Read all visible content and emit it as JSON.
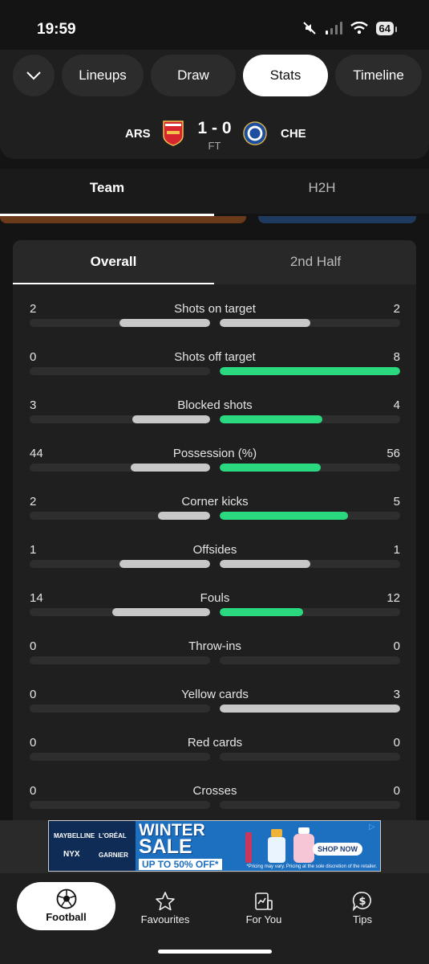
{
  "status_bar": {
    "time": "19:59",
    "battery": "64"
  },
  "nav": {
    "tabs": [
      "Lineups",
      "Draw",
      "Stats",
      "Timeline"
    ],
    "active": "Stats"
  },
  "match": {
    "home": "ARS",
    "away": "CHE",
    "score": "1 - 0",
    "status": "FT"
  },
  "view_tabs": [
    "Team",
    "H2H"
  ],
  "period_tabs": [
    "Overall",
    "2nd Half"
  ],
  "stats": [
    {
      "label": "Shots on target",
      "home": "2",
      "away": "2",
      "home_ratio": 0.5,
      "away_ratio": 0.5,
      "away_color": "#c8c8c8"
    },
    {
      "label": "Shots off target",
      "home": "0",
      "away": "8",
      "home_ratio": 0,
      "away_ratio": 1.0,
      "away_color": "#2ad97f"
    },
    {
      "label": "Blocked shots",
      "home": "3",
      "away": "4",
      "home_ratio": 0.43,
      "away_ratio": 0.57,
      "away_color": "#2ad97f"
    },
    {
      "label": "Possession (%)",
      "home": "44",
      "away": "56",
      "home_ratio": 0.44,
      "away_ratio": 0.56,
      "away_color": "#2ad97f"
    },
    {
      "label": "Corner kicks",
      "home": "2",
      "away": "5",
      "home_ratio": 0.29,
      "away_ratio": 0.71,
      "away_color": "#2ad97f"
    },
    {
      "label": "Offsides",
      "home": "1",
      "away": "1",
      "home_ratio": 0.5,
      "away_ratio": 0.5,
      "away_color": "#c8c8c8"
    },
    {
      "label": "Fouls",
      "home": "14",
      "away": "12",
      "home_ratio": 0.54,
      "away_ratio": 0.46,
      "away_color": "#2ad97f"
    },
    {
      "label": "Throw-ins",
      "home": "0",
      "away": "0",
      "home_ratio": 0,
      "away_ratio": 0,
      "away_color": "#c8c8c8"
    },
    {
      "label": "Yellow cards",
      "home": "0",
      "away": "3",
      "home_ratio": 0,
      "away_ratio": 1.0,
      "away_color": "#c8c8c8"
    },
    {
      "label": "Red cards",
      "home": "0",
      "away": "0",
      "home_ratio": 0,
      "away_ratio": 0,
      "away_color": "#c8c8c8"
    },
    {
      "label": "Crosses",
      "home": "0",
      "away": "0",
      "home_ratio": 0,
      "away_ratio": 0,
      "away_color": "#c8c8c8"
    }
  ],
  "ad": {
    "brands": [
      "MAYBELLINE",
      "L'ORÉAL",
      "NYX",
      "GARNIER"
    ],
    "headline_1": "WINTER",
    "headline_2": "SALE",
    "offer": "UP TO 50% OFF*",
    "cta": "SHOP NOW",
    "fine_print": "*Pricing may vary. Pricing at the sole discretion of the retailer."
  },
  "bottom_nav": [
    {
      "label": "Football",
      "icon": "football-icon"
    },
    {
      "label": "Favourites",
      "icon": "star-icon"
    },
    {
      "label": "For You",
      "icon": "for-you-icon"
    },
    {
      "label": "Tips",
      "icon": "tips-icon"
    }
  ],
  "colors": {
    "accent_green": "#2ad97f",
    "home_bar": "#c8c8c8",
    "background": "#141414"
  }
}
